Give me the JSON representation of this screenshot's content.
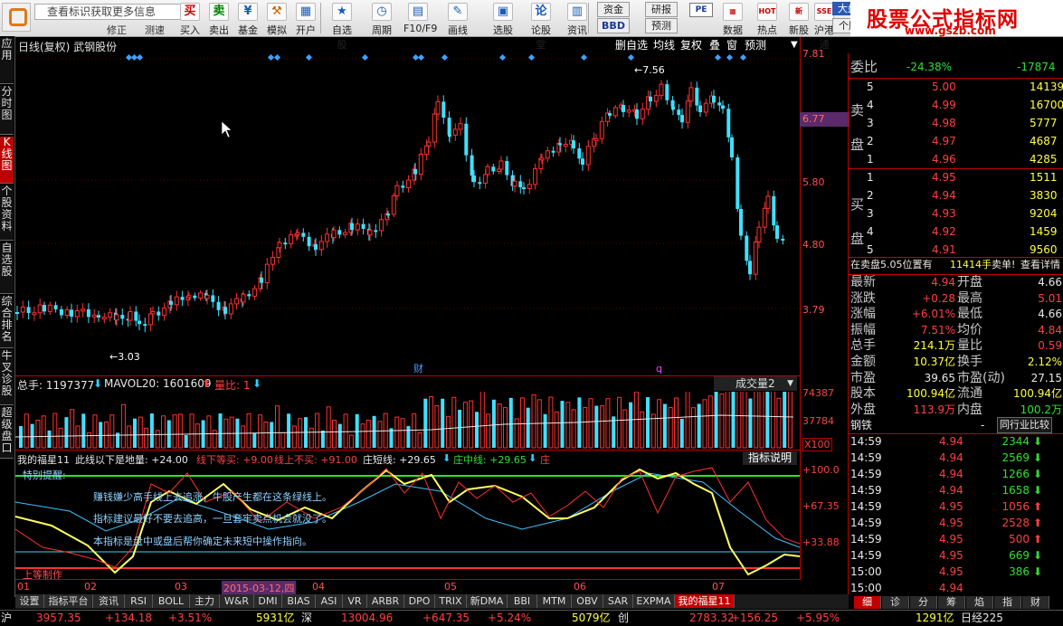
{
  "toolbar": {
    "notice": "查看标识获取更多信息",
    "notice_sub": [
      "修正",
      "测速"
    ],
    "buttons": [
      {
        "label": "买入",
        "icon": "买",
        "color": "#d00000"
      },
      {
        "label": "卖出",
        "icon": "卖",
        "color": "#008000"
      },
      {
        "label": "基金",
        "icon": "¥",
        "color": "#1a5bb5"
      },
      {
        "label": "模拟",
        "icon": "⚒",
        "color": "#c86000"
      },
      {
        "label": "开户",
        "icon": "▦",
        "color": "#1a5bb5"
      },
      {
        "label": "自选股",
        "icon": "★",
        "color": "#1a5bb5"
      },
      {
        "label": "周期",
        "icon": "◷",
        "color": "#1a5bb5"
      },
      {
        "label": "F10/F9",
        "icon": "▤",
        "color": "#1a5bb5"
      },
      {
        "label": "画线",
        "icon": "✎",
        "color": "#1a5bb5"
      },
      {
        "label": "选股",
        "icon": "▣",
        "color": "#1a5bb5"
      },
      {
        "label": "论股堂",
        "icon": "论",
        "color": "#1a5bb5"
      },
      {
        "label": "资讯",
        "icon": "▥",
        "color": "#1a5bb5"
      }
    ],
    "mid": {
      "fund": "资金",
      "bbd": "BBD",
      "research": "研报",
      "forecast": "预测",
      "pe": "PE"
    },
    "right_buttons": [
      {
        "label": "数据",
        "icon": "▦"
      },
      {
        "label": "热点",
        "icon": "HOT"
      },
      {
        "label": "新股",
        "icon": "新"
      },
      {
        "label": "沪港通",
        "icon": "SSE"
      }
    ],
    "dapan": "大盘",
    "gegu": "个股"
  },
  "brand": {
    "title": "股票公式指标网",
    "url": "www.gszb.com"
  },
  "left_tabs": [
    "应用",
    "分时图",
    "K线图",
    "个股资料",
    "自选股",
    "综合排名",
    "牛叉诊股",
    "超级盘口"
  ],
  "chart": {
    "title": "日线(复权) 武钢股份",
    "header_buttons": [
      "删自选",
      "均线",
      "复权",
      "叠",
      "窗",
      "预测"
    ],
    "price_labels": [
      "7.81",
      "6.77",
      "5.80",
      "4.80",
      "3.79"
    ],
    "current_price": "6.77",
    "high_mark": "←7.56",
    "low_mark": "←3.03",
    "markers": [
      "财",
      "q"
    ]
  },
  "volume": {
    "label_total": "总手: 1197377",
    "label_mavol": "MAVOL20: 1601609",
    "label_ratio": "量比: 1",
    "dropdown": "成交量2",
    "scale": [
      "74387",
      "37784",
      "X100"
    ]
  },
  "indicator": {
    "name": "我的福星11",
    "line1": "此线以下是地量: +24.00",
    "line2": "线下等买: +9.00",
    "line3": "线上不买: +91.00",
    "line4": "庄短线: +29.65",
    "line5": "庄中线: +29.65",
    "line6": "庄",
    "explain_btn": "指标说明",
    "scale": [
      "+100.0",
      "+67.35",
      "+33.88"
    ],
    "notes": [
      "特别提醒:",
      "赚钱嫌少高手线上去追涨，牛股产生都在这条绿线上。",
      "指标建议最好不要去追高，一旦套牢卖点机会就没了。",
      "本指标是盘中或盘后帮你确定未来短中操作指向。",
      "上等制作"
    ]
  },
  "xaxis": {
    "labels": [
      "01",
      "02",
      "03",
      "04",
      "05",
      "06",
      "07"
    ],
    "cursor_date": "2015-03-12,四"
  },
  "bottom_tabs": [
    "设置",
    "指标平台",
    "资讯",
    "RSI",
    "BOLL",
    "主力",
    "W&R",
    "DMI",
    "BIAS",
    "ASI",
    "VR",
    "ARBR",
    "DPO",
    "TRIX",
    "新DMA",
    "BBI",
    "MTM",
    "OBV",
    "SAR",
    "EXPMA",
    "我的福星11"
  ],
  "right_tabs": [
    "细",
    "诊",
    "分",
    "筹",
    "焰",
    "指",
    "财"
  ],
  "status": {
    "sh_label": "沪",
    "sh_index": "3957.35",
    "sh_change": "+134.18",
    "sh_pct": "+3.51%",
    "sh_amount": "5931亿",
    "sz_label": "深",
    "sz_index": "13004.96",
    "sz_change": "+647.35",
    "sz_pct": "+5.24%",
    "sz_amount": "5079亿",
    "cy_label": "创",
    "cy_index": "2783.32",
    "cy_change": "+156.25",
    "cy_pct": "+5.95%",
    "last_amount": "1291亿",
    "last_label": "日经225"
  },
  "quote": {
    "weibi_label": "委比",
    "weibi_value": "-24.38%",
    "weicha_value": "-17874",
    "sell_label": "卖盘",
    "buy_label": "买盘",
    "sell": [
      {
        "level": "5",
        "price": "5.00",
        "vol": "14139"
      },
      {
        "level": "4",
        "price": "4.99",
        "vol": "16700"
      },
      {
        "level": "3",
        "price": "4.98",
        "vol": "5777"
      },
      {
        "level": "2",
        "price": "4.97",
        "vol": "4687"
      },
      {
        "level": "1",
        "price": "4.96",
        "vol": "4285"
      }
    ],
    "buy": [
      {
        "level": "1",
        "price": "4.95",
        "vol": "1511"
      },
      {
        "level": "2",
        "price": "4.94",
        "vol": "3830"
      },
      {
        "level": "3",
        "price": "4.93",
        "vol": "9204"
      },
      {
        "level": "4",
        "price": "4.92",
        "vol": "1459"
      },
      {
        "level": "5",
        "price": "4.91",
        "vol": "9560"
      }
    ],
    "info_line": "在卖盘5.05位置有",
    "info_vol": "11414手",
    "info_tail": "卖单!",
    "info_link": "查看详情",
    "stats": [
      {
        "l1": "最新",
        "v1": "4.94",
        "l2": "开盘",
        "v2": "4.66"
      },
      {
        "l1": "涨跌",
        "v1": "+0.28",
        "l2": "最高",
        "v2": "5.01"
      },
      {
        "l1": "涨幅",
        "v1": "+6.01%",
        "l2": "最低",
        "v2": "4.66"
      },
      {
        "l1": "振幅",
        "v1": "7.51%",
        "l2": "均价",
        "v2": "4.84"
      },
      {
        "l1": "总手",
        "v1": "214.1万",
        "l2": "量比",
        "v2": "0.59"
      },
      {
        "l1": "金额",
        "v1": "10.37亿",
        "l2": "换手",
        "v2": "2.12%"
      },
      {
        "l1": "市盈",
        "v1": "39.65",
        "l2": "市盈(动)",
        "v2": "27.15"
      },
      {
        "l1": "股本",
        "v1": "100.94亿",
        "l2": "流通",
        "v2": "100.94亿"
      },
      {
        "l1": "外盘",
        "v1": "113.9万",
        "l2": "内盘",
        "v2": "100.2万"
      }
    ],
    "sector_label": "钢铁",
    "sector_dash": "-",
    "sector_btn": "同行业比较",
    "ticks": [
      {
        "t": "14:59",
        "p": "4.94",
        "v": "2344",
        "dir": "down"
      },
      {
        "t": "14:59",
        "p": "4.94",
        "v": "2569",
        "dir": "down"
      },
      {
        "t": "14:59",
        "p": "4.94",
        "v": "1266",
        "dir": "down"
      },
      {
        "t": "14:59",
        "p": "4.94",
        "v": "1658",
        "dir": "down"
      },
      {
        "t": "14:59",
        "p": "4.95",
        "v": "1056",
        "dir": "up"
      },
      {
        "t": "14:59",
        "p": "4.95",
        "v": "2528",
        "dir": "up"
      },
      {
        "t": "14:59",
        "p": "4.95",
        "v": "500",
        "dir": "up"
      },
      {
        "t": "14:59",
        "p": "4.95",
        "v": "669",
        "dir": "down"
      },
      {
        "t": "15:00",
        "p": "4.95",
        "v": "386",
        "dir": "down"
      },
      {
        "t": "15:00",
        "p": "4.94",
        "v": "",
        "dir": "none"
      }
    ]
  }
}
